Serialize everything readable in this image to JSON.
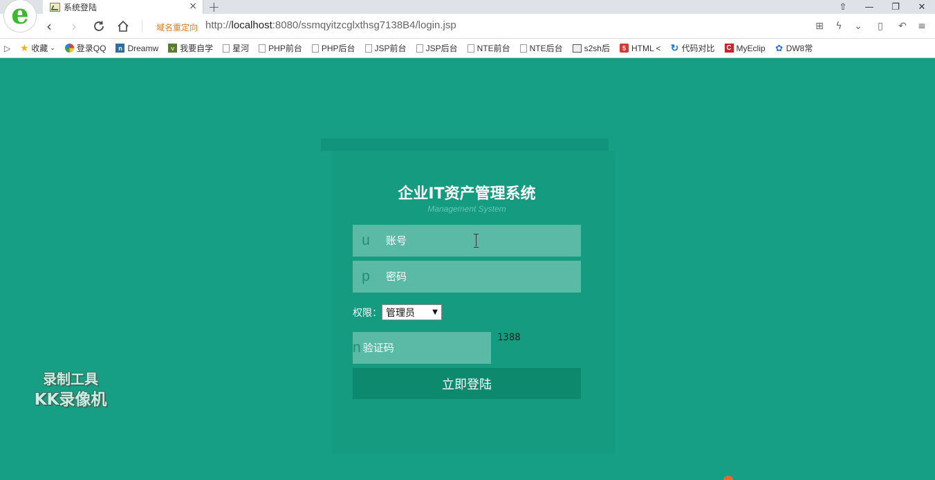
{
  "browser": {
    "tab_title": "系统登陆",
    "tab_close": "×",
    "new_tab": "+",
    "redirect_label": "域名重定向",
    "url_prefix": "http://",
    "url_host": "localhost",
    "url_rest": ":8080/ssmqyitzcglxthsg7138B4/login.jsp",
    "window_controls": [
      "⇧",
      "—",
      "❐",
      "✕"
    ],
    "bookmarks": [
      {
        "icon": "star-icon",
        "label": "收藏"
      },
      {
        "icon": "qq-icon",
        "label": "登录QQ"
      },
      {
        "icon": "dreamweaver-icon",
        "label": "Dreamw"
      },
      {
        "icon": "leaf-icon",
        "label": "我要自学"
      },
      {
        "icon": "page-icon",
        "label": "星河"
      },
      {
        "icon": "page-icon",
        "label": "PHP前台"
      },
      {
        "icon": "page-icon",
        "label": "PHP后台"
      },
      {
        "icon": "page-icon",
        "label": "JSP前台"
      },
      {
        "icon": "page-icon",
        "label": "JSP后台"
      },
      {
        "icon": "page-icon",
        "label": "NTE前台"
      },
      {
        "icon": "page-icon",
        "label": "NTE后台"
      },
      {
        "icon": "picture-icon",
        "label": "s2sh后"
      },
      {
        "icon": "html5-icon",
        "label": "HTML <"
      },
      {
        "icon": "compare-icon",
        "label": "代码对比"
      },
      {
        "icon": "eclipse-icon",
        "label": "MyEclip"
      },
      {
        "icon": "paw-icon",
        "label": "DW8常"
      }
    ]
  },
  "login": {
    "title": "企业IT资产管理系统",
    "subtitle": "Management System",
    "username": {
      "letter": "u",
      "placeholder": "账号"
    },
    "password": {
      "letter": "p",
      "placeholder": "密码"
    },
    "role_label": "权限：",
    "role_selected": "管理员",
    "code": {
      "letter": "n",
      "placeholder": "验证码"
    },
    "captcha": "1388",
    "submit_label": "立即登陆"
  },
  "watermark": {
    "line1": "录制工具",
    "line2": "KK录像机"
  },
  "colors": {
    "background": "#169f84",
    "field": "#5bbaa6",
    "button": "#0d8a6d"
  }
}
